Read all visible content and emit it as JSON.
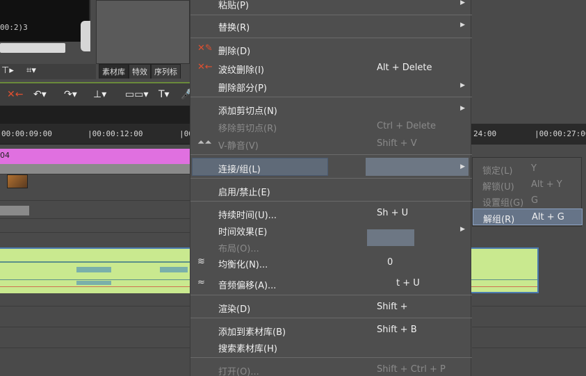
{
  "background": {
    "preview_timecode": "00:2)3",
    "bin_tabs": [
      "素材库",
      "特效",
      "序列标"
    ],
    "ruler_ticks": [
      "00:00:09:00",
      "|00:00:12:00",
      "|00:00:",
      "24:00",
      "|00:00:27:00"
    ],
    "track_label": "04"
  },
  "menu": {
    "items": [
      {
        "label": "粘贴(P)",
        "shortcut": "",
        "submenu": true,
        "disabled": false,
        "icon": ""
      },
      {
        "label": "替换(R)",
        "shortcut": "",
        "submenu": true,
        "disabled": false,
        "icon": ""
      },
      {
        "label": "删除(D)",
        "shortcut": "",
        "submenu": false,
        "disabled": false,
        "icon": "delete-x-icon"
      },
      {
        "label": "波纹删除(I)",
        "shortcut": "Alt + Delete",
        "submenu": false,
        "disabled": false,
        "icon": "ripple-delete-icon"
      },
      {
        "label": "删除部分(P)",
        "shortcut": "",
        "submenu": true,
        "disabled": false,
        "icon": ""
      },
      {
        "label": "添加剪切点(N)",
        "shortcut": "",
        "submenu": true,
        "disabled": false,
        "icon": ""
      },
      {
        "label": "移除剪切点(R)",
        "shortcut": "Ctrl + Delete",
        "submenu": false,
        "disabled": true,
        "icon": ""
      },
      {
        "label": "V-静音(V)",
        "shortcut": "Shift + V",
        "submenu": false,
        "disabled": true,
        "icon": "v-mute-icon"
      },
      {
        "label": "连接/组(L)",
        "shortcut": "",
        "submenu": true,
        "disabled": false,
        "icon": ""
      },
      {
        "label": "启用/禁止(E)",
        "shortcut": "",
        "submenu": false,
        "disabled": false,
        "icon": ""
      },
      {
        "label": "持续时间(U)...",
        "shortcut": "Sh  + U",
        "submenu": false,
        "disabled": false,
        "icon": ""
      },
      {
        "label": "时间效果(E)",
        "shortcut": "",
        "submenu": true,
        "disabled": false,
        "icon": ""
      },
      {
        "label": "布局(O)...",
        "shortcut": "",
        "submenu": false,
        "disabled": true,
        "icon": ""
      },
      {
        "label": "均衡化(N)...",
        "shortcut": "0",
        "submenu": false,
        "disabled": false,
        "icon": "equalize-icon"
      },
      {
        "label": "音频偏移(A)...",
        "shortcut": "t + U",
        "submenu": false,
        "disabled": false,
        "icon": "audio-offset-icon"
      },
      {
        "label": "渲染(D)",
        "shortcut": "Shift +",
        "submenu": false,
        "disabled": false,
        "icon": ""
      },
      {
        "label": "添加到素材库(B)",
        "shortcut": "Shift + B",
        "submenu": false,
        "disabled": false,
        "icon": ""
      },
      {
        "label": "搜索素材库(H)",
        "shortcut": "",
        "submenu": false,
        "disabled": false,
        "icon": ""
      },
      {
        "label": "打开(O)...",
        "shortcut": "Shift + Ctrl + P",
        "submenu": false,
        "disabled": true,
        "icon": ""
      }
    ]
  },
  "submenu": {
    "items": [
      {
        "label": "锁定(L)",
        "shortcut": "Y",
        "disabled": true
      },
      {
        "label": "解锁(U)",
        "shortcut": "Alt + Y",
        "disabled": true
      },
      {
        "label": "设置组(G)",
        "shortcut": "G",
        "disabled": true
      },
      {
        "label": "解组(R)",
        "shortcut": "Alt + G",
        "disabled": false
      }
    ]
  },
  "colors": {
    "menu_bg": "#4e4e4e",
    "highlight": "#5f6a78",
    "submenu_active": "#667488",
    "video_track": "#e070e0",
    "audio_track": "#c9e98f"
  }
}
